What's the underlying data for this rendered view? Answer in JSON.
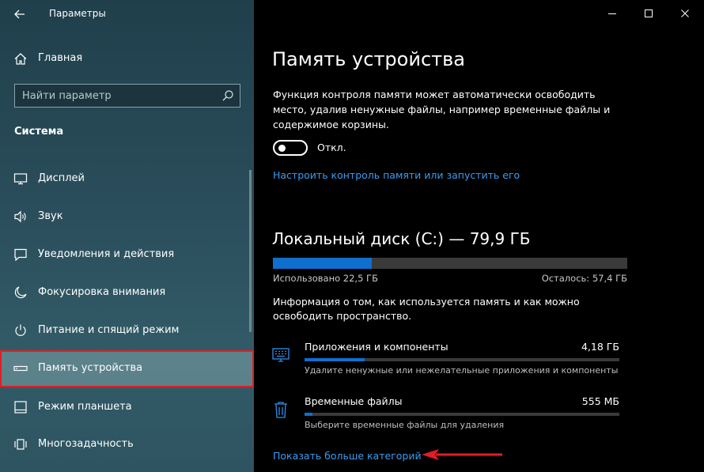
{
  "app": {
    "title": "Параметры"
  },
  "sidebar": {
    "home_label": "Главная",
    "search_placeholder": "Найти параметр",
    "section_title": "Система",
    "items": [
      {
        "label": "Дисплей",
        "icon": "monitor-icon"
      },
      {
        "label": "Звук",
        "icon": "speaker-icon"
      },
      {
        "label": "Уведомления и действия",
        "icon": "notification-icon"
      },
      {
        "label": "Фокусировка внимания",
        "icon": "moon-icon"
      },
      {
        "label": "Питание и спящий режим",
        "icon": "power-icon"
      },
      {
        "label": "Память устройства",
        "icon": "storage-icon",
        "selected": true
      },
      {
        "label": "Режим планшета",
        "icon": "tablet-icon"
      },
      {
        "label": "Многозадачность",
        "icon": "multitasking-icon"
      }
    ]
  },
  "main": {
    "title": "Память устройства",
    "description": "Функция контроля памяти может автоматически освободить место, удалив ненужные файлы, например временные файлы и содержимое корзины.",
    "storage_sense_toggle": {
      "state_label": "Откл.",
      "on": false
    },
    "configure_link": "Настроить контроль памяти или запустить его",
    "disk": {
      "title": "Локальный диск (C:) — 79,9 ГБ",
      "used_label": "Использовано 22,5 ГБ",
      "free_label": "Осталось: 57,4 ГБ",
      "used_fraction": 0.28
    },
    "info_text": "Информация о том, как используется память и как можно освободить пространство.",
    "categories": [
      {
        "name": "Приложения и компоненты",
        "size": "4,18 ГБ",
        "description": "Удалите ненужные или нежелательные приложения и компоненты",
        "icon": "apps-icon",
        "fraction": 0.19
      },
      {
        "name": "Временные файлы",
        "size": "555 МБ",
        "description": "Выберите временные файлы для удаления",
        "icon": "trash-icon",
        "fraction": 0.025
      }
    ],
    "more_link": "Показать больше категорий"
  },
  "colors": {
    "accent": "#0f6fce",
    "link": "#3b9bf0",
    "highlight": "#e21d24"
  }
}
